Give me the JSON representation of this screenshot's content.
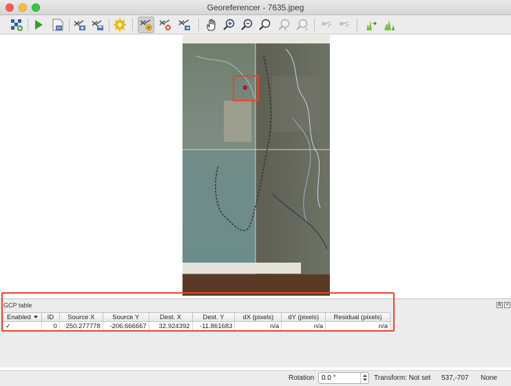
{
  "window": {
    "title": "Georeferencer - 7635.jpeg"
  },
  "toolbar": {
    "buttons": [
      {
        "name": "open-raster-button",
        "icon": "open-raster-icon",
        "active": false,
        "enabled": true
      },
      {
        "name": "start-georeferencing-button",
        "icon": "play-icon",
        "active": false,
        "enabled": true
      },
      {
        "name": "generate-gdal-script-button",
        "icon": "gdal-script-icon",
        "active": false,
        "enabled": true
      },
      {
        "name": "load-gcp-points-button",
        "icon": "load-gcp-icon",
        "active": false,
        "enabled": true
      },
      {
        "name": "save-gcp-points-button",
        "icon": "save-gcp-icon",
        "active": false,
        "enabled": true
      },
      {
        "name": "transformation-settings-button",
        "icon": "gear-icon",
        "active": false,
        "enabled": true
      },
      {
        "name": "add-point-button",
        "icon": "add-point-icon",
        "active": true,
        "enabled": true
      },
      {
        "name": "delete-point-button",
        "icon": "delete-point-icon",
        "active": false,
        "enabled": true
      },
      {
        "name": "move-gcp-point-button",
        "icon": "move-point-icon",
        "active": false,
        "enabled": true
      },
      {
        "name": "pan-button",
        "icon": "pan-hand-icon",
        "active": false,
        "enabled": true
      },
      {
        "name": "zoom-in-button",
        "icon": "zoom-in-icon",
        "active": false,
        "enabled": true
      },
      {
        "name": "zoom-out-button",
        "icon": "zoom-out-icon",
        "active": false,
        "enabled": true
      },
      {
        "name": "zoom-to-layer-button",
        "icon": "zoom-layer-icon",
        "active": false,
        "enabled": true
      },
      {
        "name": "zoom-last-button",
        "icon": "zoom-last-icon",
        "active": false,
        "enabled": false
      },
      {
        "name": "zoom-next-button",
        "icon": "zoom-next-icon",
        "active": false,
        "enabled": false
      },
      {
        "name": "link-georeferencer-to-qgis-button",
        "icon": "link-geo-icon",
        "active": false,
        "enabled": false
      },
      {
        "name": "link-qgis-to-georeferencer-button",
        "icon": "link-qgis-icon",
        "active": false,
        "enabled": false
      },
      {
        "name": "full-histogram-stretch-button",
        "icon": "histogram-full-icon",
        "active": false,
        "enabled": true
      },
      {
        "name": "local-histogram-stretch-button",
        "icon": "histogram-local-icon",
        "active": false,
        "enabled": true
      }
    ]
  },
  "gcp": {
    "title": "GCP table",
    "columns": [
      "Enabled",
      "ID",
      "Source X",
      "Source Y",
      "Dest. X",
      "Dest. Y",
      "dX (pixels)",
      "dY (pixels)",
      "Residual (pixels)"
    ],
    "rows": [
      {
        "enabled": "✓",
        "id": "0",
        "source_x": "250.277778",
        "source_y": "-206.666667",
        "dest_x": "32.924392",
        "dest_y": "-11.861683",
        "dx": "n/a",
        "dy": "n/a",
        "residual": "n/a"
      }
    ],
    "float_glyph": "⧉",
    "close_glyph": "✕"
  },
  "status": {
    "rotation_label": "Rotation",
    "rotation_value": "0.0 °",
    "transform": "Transform: Not set",
    "coords": "537,-707",
    "crs": "None"
  },
  "colors": {
    "highlight": "#e8442a",
    "accent_green": "#3a9a2c",
    "accent_yellow": "#f0c419"
  }
}
